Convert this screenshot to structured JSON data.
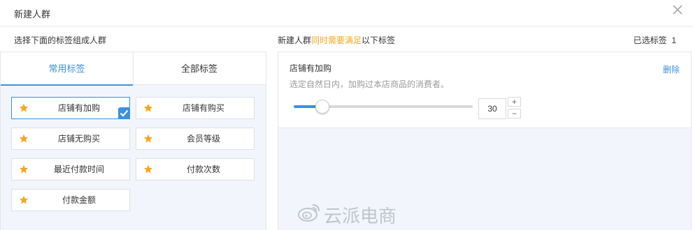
{
  "dialog": {
    "title": "新建人群",
    "close_icon": "close-icon"
  },
  "left": {
    "note": "选择下面的标签组成人群",
    "tabs": [
      {
        "label": "常用标签",
        "active": true
      },
      {
        "label": "全部标签",
        "active": false
      }
    ],
    "tags": [
      {
        "label": "店铺有加购",
        "icon": "star-icon",
        "selected": true
      },
      {
        "label": "店铺有购买",
        "icon": "star-icon",
        "selected": false
      },
      {
        "label": "店铺无购买",
        "icon": "star-icon",
        "selected": false
      },
      {
        "label": "会员等级",
        "icon": "star-icon",
        "selected": false
      },
      {
        "label": "最近付款时间",
        "icon": "star-icon",
        "selected": false
      },
      {
        "label": "付款次数",
        "icon": "star-icon",
        "selected": false
      },
      {
        "label": "付款金额",
        "icon": "star-icon",
        "selected": false
      }
    ]
  },
  "right": {
    "note_prefix": "新建人群",
    "note_highlight": "同时需要满足",
    "note_suffix": "以下标签",
    "selected_count_label": "已选标签",
    "selected_count": "1",
    "card": {
      "title": "店铺有加购",
      "description": "选定自然日内，加购过本店商品的消费者。",
      "delete_label": "删除",
      "slider_fraction": 0.16,
      "value": "30",
      "plus_label": "+",
      "minus_label": "−"
    }
  },
  "watermark": {
    "text": "云派电商",
    "icon": "weibo-icon"
  },
  "colors": {
    "accent": "#3d8fe0",
    "highlight": "#f5a623",
    "star": "#f5a623",
    "panel_bg": "#f2f6fc"
  }
}
